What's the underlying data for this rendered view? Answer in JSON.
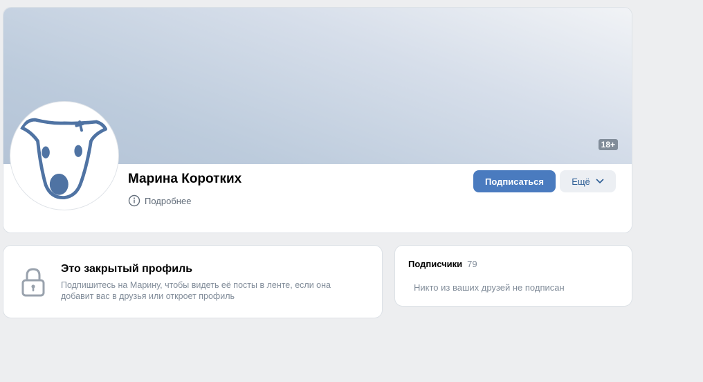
{
  "profile": {
    "name": "Марина Коротких",
    "details_label": "Подробнее",
    "age_badge": "18+",
    "subscribe_label": "Подписаться",
    "more_label": "Ещё",
    "avatar_icon": "vk-dog-camera-icon",
    "accent_color": "#4a7bbf"
  },
  "closed_profile": {
    "title": "Это закрытый профиль",
    "description": "Подпишитесь на Марину, чтобы видеть её посты в ленте, если она добавит вас в друзья или откроет профиль",
    "icon": "lock-icon"
  },
  "subscribers": {
    "title": "Подписчики",
    "count": "79",
    "empty_text": "Никто из ваших друзей не подписан"
  }
}
